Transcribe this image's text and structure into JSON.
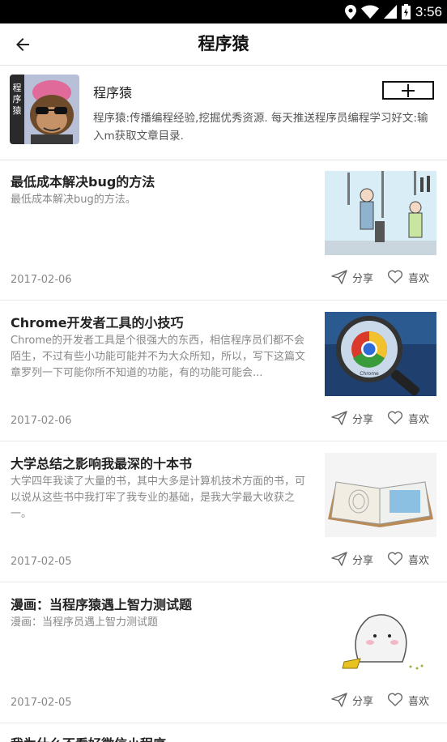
{
  "status_bar": {
    "time": "3:56",
    "icons": [
      "location-icon",
      "wifi-icon",
      "signal-icon",
      "battery-icon"
    ]
  },
  "header": {
    "title": "程序猿",
    "back_icon": "back-arrow-icon"
  },
  "account": {
    "name": "程序猿",
    "follow_icon": "plus-icon",
    "description": "程序猿:传播编程经验,挖掘优秀资源. 每天推送程序员编程学习好文:输入m获取文章目录.",
    "avatar_text": "程序猿"
  },
  "articles": [
    {
      "title": "最低成本解决bug的方法",
      "summary": "最低成本解决bug的方法。",
      "date": "2017-02-06",
      "share_label": "分享",
      "like_label": "喜欢"
    },
    {
      "title": "Chrome开发者工具的小技巧",
      "summary": "Chrome的开发者工具是个很强大的东西，相信程序员们都不会陌生，不过有些小功能可能并不为大众所知，所以，写下这篇文章罗列一下可能你所不知道的功能，有的功能可能会...",
      "date": "2017-02-06",
      "share_label": "分享",
      "like_label": "喜欢"
    },
    {
      "title": "大学总结之影响我最深的十本书",
      "summary": "大学四年我读了大量的书，其中大多是计算机技术方面的书，可以说从这些书中我打牢了我专业的基础，是我大学最大收获之一。",
      "date": "2017-02-05",
      "share_label": "分享",
      "like_label": "喜欢"
    },
    {
      "title": "漫画：当程序猿遇上智力测试题",
      "summary": "漫画：当程序员遇上智力测试题",
      "date": "2017-02-05",
      "share_label": "分享",
      "like_label": "喜欢"
    },
    {
      "title": "我为什么不看好微信小程序"
    }
  ]
}
